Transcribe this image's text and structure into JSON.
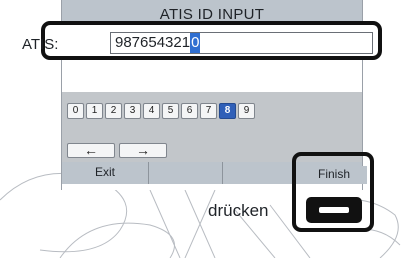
{
  "screen": {
    "title": "ATIS ID INPUT",
    "atis_label": "ATIS:",
    "atis_value": "987654321",
    "atis_cursor_char": "0"
  },
  "keypad": {
    "digits": [
      "0",
      "1",
      "2",
      "3",
      "4",
      "5",
      "6",
      "7",
      "8",
      "9"
    ],
    "selected_digit": "8",
    "left_arrow": "←",
    "right_arrow": "→"
  },
  "softkeys": {
    "exit": "Exit",
    "finish": "Finish"
  },
  "instruction": {
    "press_label": "drücken"
  },
  "colors": {
    "highlight_frame": "#111111",
    "selected_key": "#2f5fb8",
    "bar_gray": "#bcc4cc"
  }
}
